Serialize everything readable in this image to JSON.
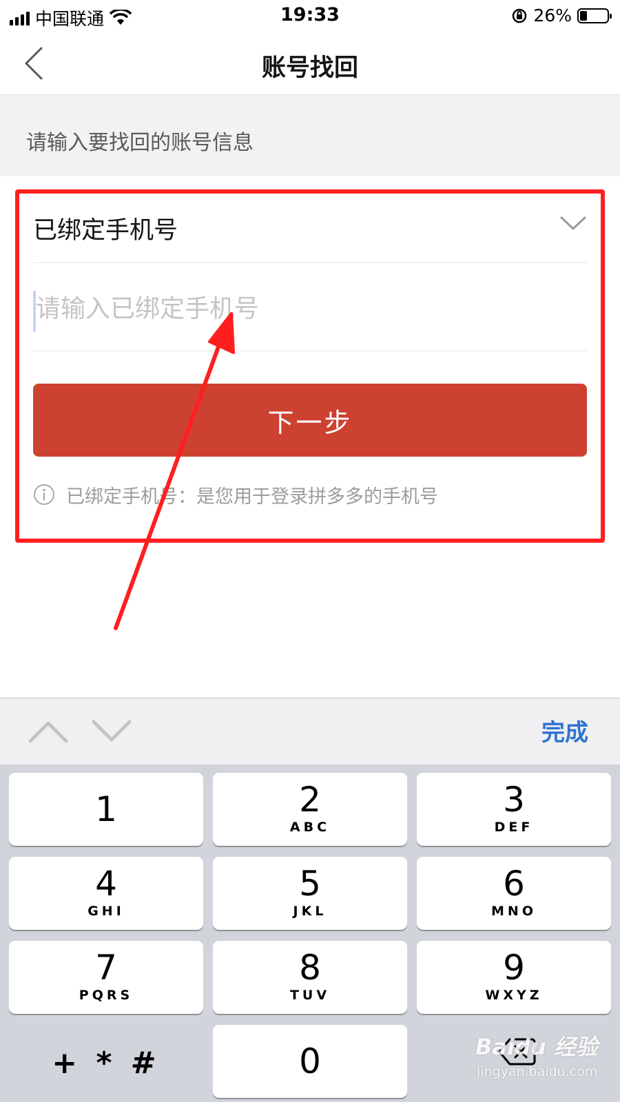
{
  "status_bar": {
    "carrier": "中国联通",
    "time": "19:33",
    "battery_percent": "26%",
    "battery_level": 0.26,
    "icons": [
      "signal-icon",
      "wifi-icon",
      "rotation-lock-icon",
      "battery-icon"
    ]
  },
  "nav": {
    "title": "账号找回",
    "back_icon": "chevron-left-icon"
  },
  "hint": {
    "text": "请输入要找回的账号信息"
  },
  "form": {
    "account_type": "已绑定手机号",
    "phone_placeholder": "请输入已绑定手机号",
    "phone_value": "",
    "next_label": "下一步",
    "tip": "已绑定手机号：是您用于登录拼多多的手机号",
    "accent_color": "#cd4130"
  },
  "keyboard": {
    "done_label": "完成",
    "keys": [
      {
        "num": "1",
        "letters": ""
      },
      {
        "num": "2",
        "letters": "ABC"
      },
      {
        "num": "3",
        "letters": "DEF"
      },
      {
        "num": "4",
        "letters": "GHI"
      },
      {
        "num": "5",
        "letters": "JKL"
      },
      {
        "num": "6",
        "letters": "MNO"
      },
      {
        "num": "7",
        "letters": "PQRS"
      },
      {
        "num": "8",
        "letters": "TUV"
      },
      {
        "num": "9",
        "letters": "WXYZ"
      },
      {
        "num": "0",
        "letters": ""
      }
    ],
    "symbols_label": "+ * #"
  },
  "watermark": {
    "brand": "Baidu 经验",
    "url": "jingyan.baidu.com"
  },
  "annotation": {
    "color": "#ff1f1f"
  }
}
